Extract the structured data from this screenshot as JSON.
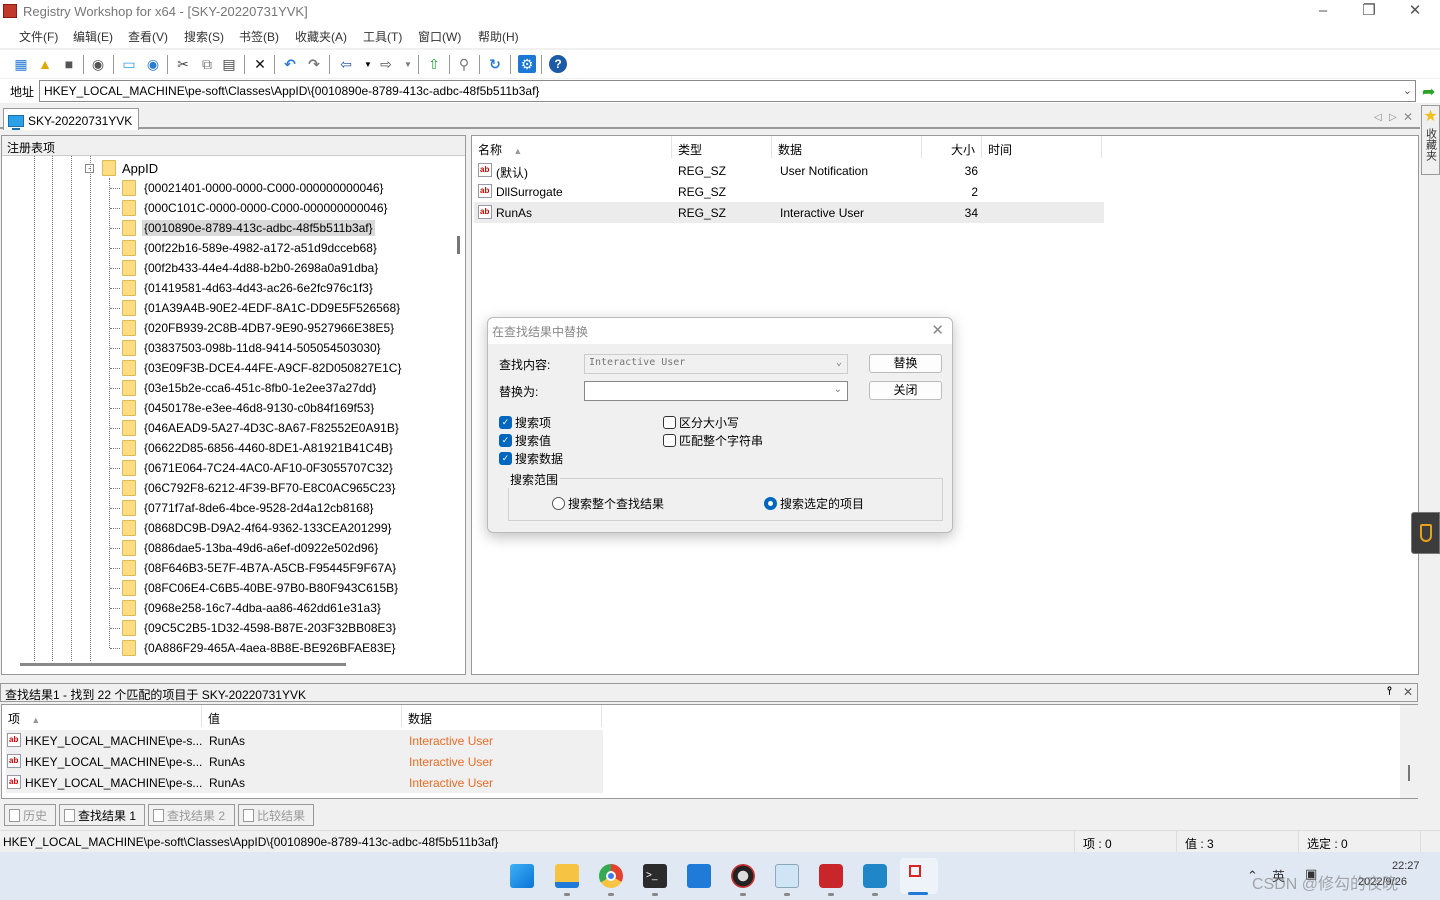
{
  "window": {
    "title": "Registry Workshop for x64 - [SKY-20220731YVK]",
    "controls": [
      "minimize",
      "restore",
      "close"
    ]
  },
  "menu": [
    "文件(F)",
    "编辑(E)",
    "查看(V)",
    "搜索(S)",
    "书签(B)",
    "收藏夹(A)",
    "工具(T)",
    "窗口(W)",
    "帮助(H)"
  ],
  "toolbar": {
    "icons": [
      "new-key-icon",
      "open-icon",
      "save-icon",
      "snapshot-icon",
      "local-computer-icon",
      "remote-computer-icon",
      "cut-icon",
      "copy-icon",
      "paste-icon",
      "delete-icon",
      "undo-icon",
      "redo-icon",
      "back-icon",
      "back-dropdown-icon",
      "forward-icon",
      "forward-dropdown-icon",
      "parent-key-icon",
      "find-icon",
      "refresh-icon",
      "options-icon",
      "help-icon"
    ]
  },
  "address": {
    "label": "地址",
    "value": "HKEY_LOCAL_MACHINE\\pe-soft\\Classes\\AppID\\{0010890e-8789-413c-adbc-48f5b511b3af}"
  },
  "doc_tab": {
    "label": "SKY-20220731YVK"
  },
  "favorites_sidebar": {
    "label": "收藏夹"
  },
  "tree": {
    "header": "注册表项",
    "parent": "AppID",
    "items": [
      "{00021401-0000-0000-C000-000000000046}",
      "{000C101C-0000-0000-C000-000000000046}",
      "{0010890e-8789-413c-adbc-48f5b511b3af}",
      "{00f22b16-589e-4982-a172-a51d9dcceb68}",
      "{00f2b433-44e4-4d88-b2b0-2698a0a91dba}",
      "{01419581-4d63-4d43-ac26-6e2fc976c1f3}",
      "{01A39A4B-90E2-4EDF-8A1C-DD9E5F526568}",
      "{020FB939-2C8B-4DB7-9E90-9527966E38E5}",
      "{03837503-098b-11d8-9414-505054503030}",
      "{03E09F3B-DCE4-44FE-A9CF-82D050827E1C}",
      "{03e15b2e-cca6-451c-8fb0-1e2ee37a27dd}",
      "{0450178e-e3ee-46d8-9130-c0b84f169f53}",
      "{046AEAD9-5A27-4D3C-8A67-F82552E0A91B}",
      "{06622D85-6856-4460-8DE1-A81921B41C4B}",
      "{0671E064-7C24-4AC0-AF10-0F3055707C32}",
      "{06C792F8-6212-4F39-BF70-E8C0AC965C23}",
      "{0771f7af-8de6-4bce-9528-2d4a12cb8168}",
      "{0868DC9B-D9A2-4f64-9362-133CEA201299}",
      "{0886dae5-13ba-49d6-a6ef-d0922e502d96}",
      "{08F646B3-5E7F-4B7A-A5CB-F95445F9F67A}",
      "{08FC06E4-C6B5-40BE-97B0-B80F943C615B}",
      "{0968e258-16c7-4dba-aa86-462dd61e31a3}",
      "{09C5C2B5-1D32-4598-B87E-203F32BB08E3}",
      "{0A886F29-465A-4aea-8B8E-BE926BFAE83E}"
    ],
    "selected_index": 2
  },
  "values": {
    "columns": [
      "名称",
      "类型",
      "数据",
      "大小",
      "时间"
    ],
    "rows": [
      {
        "name": "(默认)",
        "type": "REG_SZ",
        "data": "User Notification",
        "size": "36",
        "time": ""
      },
      {
        "name": "DllSurrogate",
        "type": "REG_SZ",
        "data": "",
        "size": "2",
        "time": ""
      },
      {
        "name": "RunAs",
        "type": "REG_SZ",
        "data": "Interactive User",
        "size": "34",
        "time": ""
      }
    ],
    "selected_index": 2
  },
  "dialog": {
    "title": "在查找结果中替换",
    "find_label": "查找内容:",
    "find_value": "Interactive User",
    "replace_label": "替换为:",
    "replace_value": "",
    "replace_button": "替换",
    "close_button": "关闭",
    "checkboxes": [
      {
        "label": "搜索项",
        "checked": true
      },
      {
        "label": "搜索值",
        "checked": true
      },
      {
        "label": "搜索数据",
        "checked": true
      },
      {
        "label": "区分大小写",
        "checked": false
      },
      {
        "label": "匹配整个字符串",
        "checked": false
      }
    ],
    "scope_group": "搜索范围",
    "scope_options": [
      {
        "label": "搜索整个查找结果",
        "selected": false
      },
      {
        "label": "搜索选定的项目",
        "selected": true
      }
    ]
  },
  "results": {
    "title": "查找结果1 - 找到 22 个匹配的项目于 SKY-20220731YVK",
    "columns": [
      "项",
      "值",
      "数据"
    ],
    "rows": [
      {
        "key": "HKEY_LOCAL_MACHINE\\pe-s...",
        "value": "RunAs",
        "data": "Interactive User"
      },
      {
        "key": "HKEY_LOCAL_MACHINE\\pe-s...",
        "value": "RunAs",
        "data": "Interactive User"
      },
      {
        "key": "HKEY_LOCAL_MACHINE\\pe-s...",
        "value": "RunAs",
        "data": "Interactive User"
      }
    ],
    "highlight_color": "#ef6b21"
  },
  "bottom_tabs": [
    {
      "label": "历史",
      "active": false
    },
    {
      "label": "查找结果 1",
      "active": true
    },
    {
      "label": "查找结果 2",
      "active": false
    },
    {
      "label": "比较结果",
      "active": false
    }
  ],
  "status": {
    "path": "HKEY_LOCAL_MACHINE\\pe-soft\\Classes\\AppID\\{0010890e-8789-413c-adbc-48f5b511b3af}",
    "keys": "项 : 0",
    "values": "值 : 3",
    "selected": "选定 : 0"
  },
  "taskbar": {
    "apps": [
      "start-icon",
      "file-explorer-icon",
      "chrome-icon",
      "terminal-icon",
      "app-icon",
      "media-icon",
      "performance-monitor-icon",
      "registry-icon",
      "registry-workshop-icon",
      "snipping-tool-icon"
    ],
    "tray": {
      "chevron": "^",
      "ime": "英",
      "time": "22:27",
      "date": "2022/9/26"
    },
    "watermark": "CSDN @修勾的夜晚"
  }
}
